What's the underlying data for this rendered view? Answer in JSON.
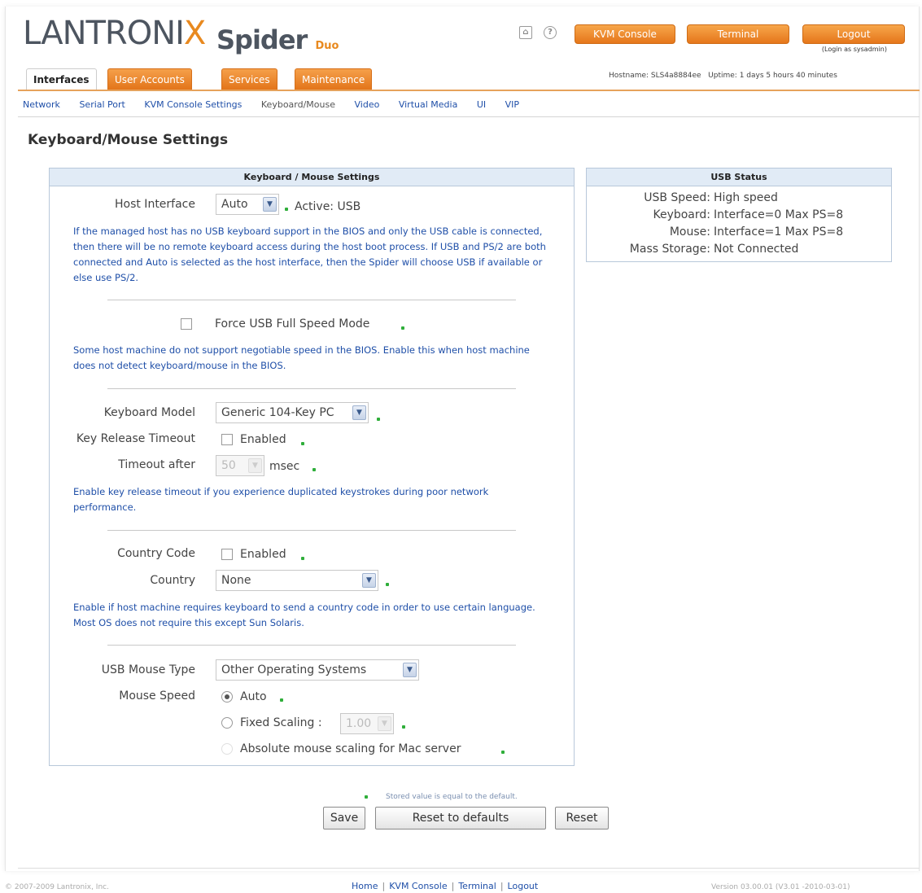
{
  "header": {
    "brand": "LANTRONIX",
    "product": "Spider",
    "product_suffix": "Duo",
    "home_icon": "home-icon",
    "help_icon": "help-icon",
    "kvm_console": "KVM Console",
    "terminal": "Terminal",
    "logout": "Logout",
    "login_as": "(Login as sysadmin)",
    "hostname": "Hostname: SLS4a8884ee",
    "uptime": "Uptime: 1 days 5 hours 40 minutes"
  },
  "tabs": [
    "Interfaces",
    "User Accounts",
    "Services",
    "Maintenance"
  ],
  "subnav": [
    "Network",
    "Serial Port",
    "KVM Console Settings",
    "Keyboard/Mouse",
    "Video",
    "Virtual Media",
    "UI",
    "VIP"
  ],
  "page_title": "Keyboard/Mouse Settings",
  "main_panel": {
    "title": "Keyboard / Mouse Settings",
    "host_interface_label": "Host Interface",
    "host_interface_value": "Auto",
    "active_text": "Active: USB",
    "host_note": "If the managed host has no USB keyboard support in the BIOS and only the USB cable is connected, then there will be no remote keyboard access during the host boot process. If USB and PS/2 are both connected and Auto is selected as the host interface, then the Spider will choose USB if available or else use PS/2.",
    "force_usb_label": "Force USB Full Speed Mode",
    "force_usb_note": "Some host machine do not support negotiable speed in the BIOS. Enable this when host machine does not detect keyboard/mouse in the BIOS.",
    "keyboard_model_label": "Keyboard Model",
    "keyboard_model_value": "Generic 104-Key PC",
    "key_release_label": "Key Release Timeout",
    "enabled_label": "Enabled",
    "timeout_after_label": "Timeout after",
    "timeout_value": "50",
    "msec": "msec",
    "key_release_note": "Enable key release timeout if you experience duplicated keystrokes during poor network performance.",
    "country_code_label": "Country Code",
    "country_code_enabled": "Enabled",
    "country_label": "Country",
    "country_value": "None",
    "country_note": "Enable if host machine requires keyboard to send a country code in order to use certain language. Most OS does not require this except Sun Solaris.",
    "usb_mouse_type_label": "USB Mouse Type",
    "usb_mouse_type_value": "Other Operating Systems",
    "mouse_speed_label": "Mouse Speed",
    "auto_label": "Auto",
    "fixed_scaling_label": "Fixed Scaling :",
    "fixed_scaling_value": "1.00",
    "absolute_label": "Absolute mouse scaling for Mac server"
  },
  "usb_status": {
    "title": "USB Status",
    "rows": [
      {
        "k": "USB Speed:",
        "v": "High speed"
      },
      {
        "k": "Keyboard:",
        "v": "Interface=0 Max PS=8"
      },
      {
        "k": "Mouse:",
        "v": "Interface=1 Max PS=8"
      },
      {
        "k": "Mass Storage:",
        "v": "Not Connected"
      }
    ]
  },
  "legend": "Stored value is equal to the default.",
  "buttons": {
    "save": "Save",
    "reset_defaults": "Reset to defaults",
    "reset": "Reset"
  },
  "footer": {
    "copyright": "© 2007-2009 Lantronix, Inc.",
    "home": "Home",
    "kvm": "KVM Console",
    "terminal": "Terminal",
    "logout": "Logout",
    "version": "Version 03.00.01 (V3.01 -2010-03-01)"
  },
  "colors": {
    "accent": "#e5761b",
    "link": "#1f4fa8",
    "default_dot": "#2fae3a"
  }
}
